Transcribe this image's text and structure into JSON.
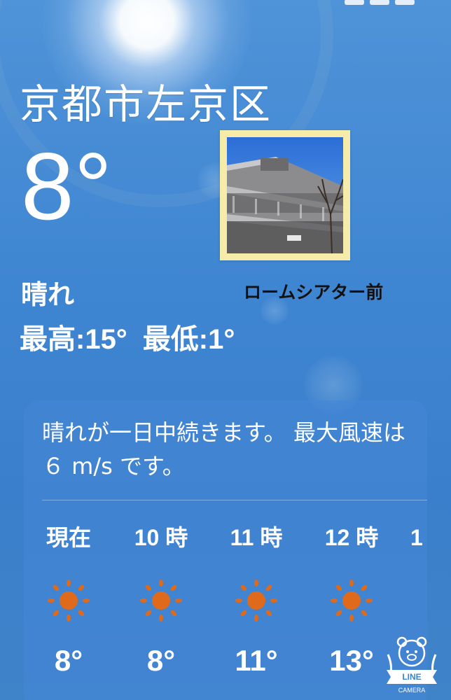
{
  "location": {
    "city": "京都市左京区",
    "temperature": "8°",
    "condition": "晴れ",
    "high": "最高:15°",
    "low": "最低:1°"
  },
  "sticker": {
    "caption": "ロームシアター前",
    "frame_color": "#f6eba8"
  },
  "forecast": {
    "summary": "晴れが一日中続きます。 最大風速は６ m/s です。",
    "hours": [
      {
        "label": "現在",
        "icon": "sun-icon",
        "temp": "8°"
      },
      {
        "label": "10 時",
        "icon": "sun-icon",
        "temp": "8°"
      },
      {
        "label": "11 時",
        "icon": "sun-icon",
        "temp": "11°"
      },
      {
        "label": "12 時",
        "icon": "sun-icon",
        "temp": "13°"
      },
      {
        "label": "1",
        "icon": "sun-icon",
        "temp": ""
      }
    ]
  },
  "colors": {
    "sky": "#3f86d2",
    "sun_icon": "#e06a1b",
    "text": "#ffffff"
  },
  "watermark": {
    "brand": "LINE",
    "sub": "CAMERA"
  }
}
